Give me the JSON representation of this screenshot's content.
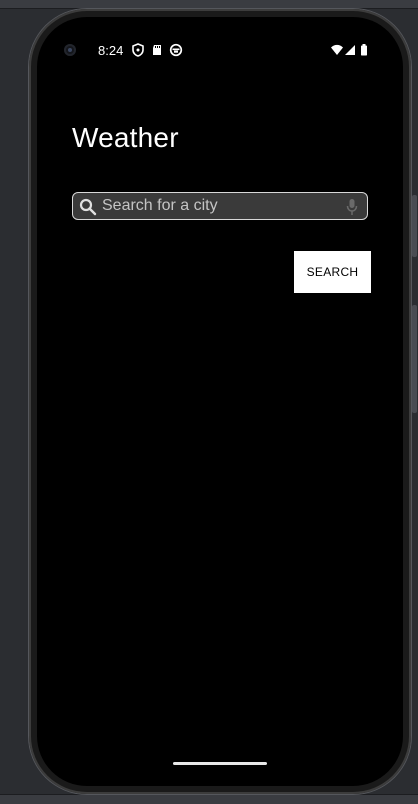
{
  "status_bar": {
    "time": "8:24",
    "left_icons": [
      "shield-icon",
      "sd-card-icon",
      "app-notification-icon"
    ],
    "right_icons": [
      "wifi-icon",
      "cell-signal-icon",
      "battery-icon"
    ]
  },
  "app": {
    "title": "Weather"
  },
  "search": {
    "placeholder": "Search for a city",
    "value": "",
    "button_label": "SEARCH"
  },
  "colors": {
    "screen_background": "#000000",
    "text_primary": "#ffffff",
    "search_field_background": "#3a3a3a",
    "search_field_border": "#d8d8d8",
    "button_background": "#ffffff",
    "button_text": "#000000",
    "emulator_background": "#2b2d31"
  }
}
